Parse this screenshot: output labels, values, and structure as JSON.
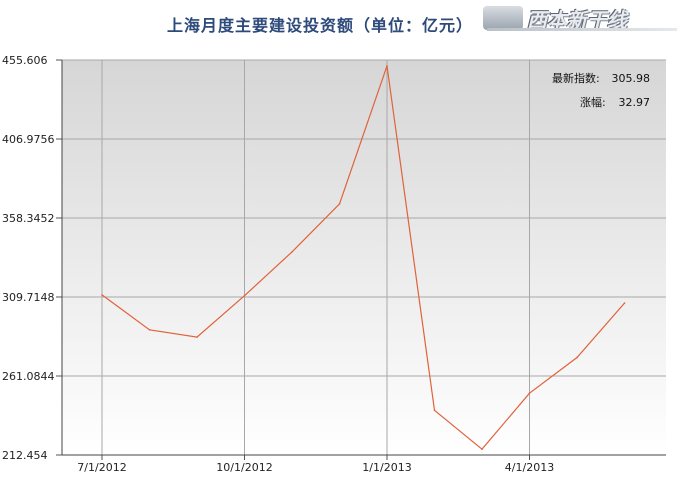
{
  "chart_data": {
    "type": "line",
    "title": "上海月度主要建设投资额（单位：亿元）",
    "x": [
      "7/1/2012",
      "8/1/2012",
      "9/1/2012",
      "10/1/2012",
      "11/1/2012",
      "12/1/2012",
      "1/1/2013",
      "2/1/2013",
      "3/1/2013",
      "4/1/2013",
      "5/1/2013",
      "6/1/2013"
    ],
    "xtick_labels": [
      "7/1/2012",
      "10/1/2012",
      "1/1/2013",
      "4/1/2013"
    ],
    "ytick_labels": [
      "455.606",
      "406.9756",
      "358.3452",
      "309.7148",
      "261.0844",
      "212.454"
    ],
    "ylim": [
      212.454,
      455.606
    ],
    "series": [
      {
        "values": [
          311.0,
          289.5,
          285.0,
          310.5,
          337.5,
          367.0,
          452.0,
          240.0,
          216.0,
          250.5,
          272.5,
          305.98
        ],
        "color": "#e0623a"
      }
    ],
    "grid": true,
    "annotations": [
      {
        "label": "最新指数:",
        "value": "305.98"
      },
      {
        "label": "涨幅:",
        "value": "32.97"
      }
    ]
  },
  "logo": {
    "text": "西本新干线"
  }
}
